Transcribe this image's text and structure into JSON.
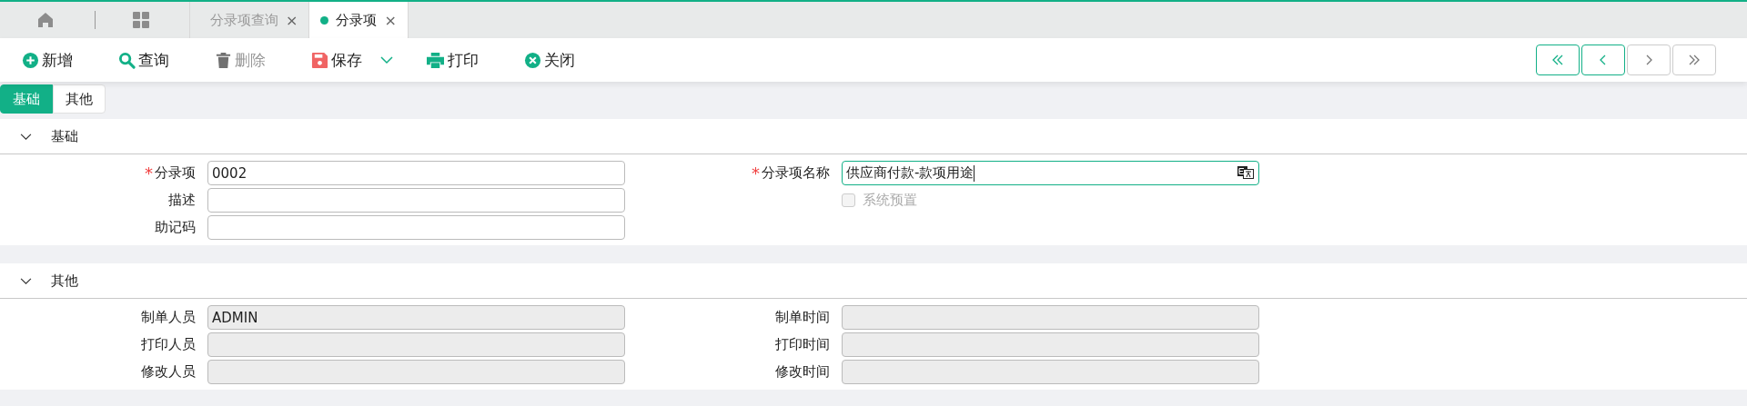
{
  "page_tabs": [
    {
      "label": "分录项查询",
      "selected": false,
      "close": "×"
    },
    {
      "label": "分录项",
      "selected": true,
      "close": "×"
    }
  ],
  "toolbar": [
    {
      "label": "新增",
      "kind": "add",
      "disabled": false
    },
    {
      "label": "查询",
      "kind": "search",
      "disabled": false
    },
    {
      "label": "删除",
      "kind": "delete",
      "disabled": true
    },
    {
      "label": "保存",
      "kind": "save",
      "disabled": false,
      "dropdown": true
    },
    {
      "label": "打印",
      "kind": "print",
      "disabled": false
    },
    {
      "label": "关闭",
      "kind": "close",
      "disabled": false
    }
  ],
  "pager": [
    {
      "kind": "first",
      "disabled": false
    },
    {
      "kind": "prev",
      "disabled": false
    },
    {
      "kind": "next",
      "disabled": true
    },
    {
      "kind": "last",
      "disabled": true
    }
  ],
  "form_tabs": [
    {
      "label": "基础",
      "selected": true
    },
    {
      "label": "其他",
      "selected": false
    }
  ],
  "sections": [
    {
      "title": "基础",
      "expanded": true,
      "columns": [
        [
          {
            "label": "分录项",
            "required_mark": "*",
            "value": "0002",
            "disabled": false
          },
          {
            "label": "描述",
            "disabled": false
          },
          {
            "label": "助记码",
            "disabled": false
          }
        ],
        [
          {
            "label": "分录项名称",
            "required_mark": "*",
            "value": "供应商付款-款项用途",
            "disabled": false,
            "focused": true,
            "translate": true
          },
          {
            "kind": "checkbox",
            "label": "系统预置",
            "checked": false,
            "disabled": true
          }
        ]
      ]
    },
    {
      "title": "其他",
      "expanded": true,
      "columns": [
        [
          {
            "label": "制单人员",
            "value": "ADMIN",
            "disabled": true
          },
          {
            "label": "打印人员",
            "disabled": true
          },
          {
            "label": "修改人员",
            "disabled": true
          }
        ],
        [
          {
            "label": "制单时间",
            "disabled": true
          },
          {
            "label": "打印时间",
            "disabled": true
          },
          {
            "label": "修改时间",
            "disabled": true
          }
        ]
      ]
    }
  ]
}
